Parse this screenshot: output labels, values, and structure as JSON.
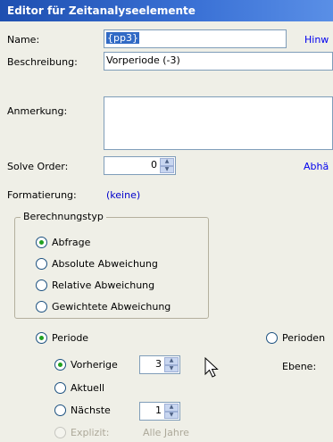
{
  "window": {
    "title": "Editor für Zeitanalyseelemente"
  },
  "form": {
    "name_label": "Name:",
    "name_value": "{pp3}",
    "hint_link": "Hinw",
    "description_label": "Beschreibung:",
    "description_value": "Vorperiode (-3)",
    "remark_label": "Anmerkung:",
    "remark_value": "",
    "solve_order_label": "Solve Order:",
    "solve_order_value": "0",
    "dependency_link": "Abhä",
    "formatting_label": "Formatierung:",
    "formatting_value": "(keine)"
  },
  "calc_type": {
    "legend": "Berechnungstyp",
    "options": [
      "Abfrage",
      "Absolute Abweichung",
      "Relative Abweichung",
      "Gewichtete Abweichung"
    ],
    "selected": "Abfrage"
  },
  "period": {
    "periode_label": "Periode",
    "perioden_label": "Perioden",
    "previous_label": "Vorherige",
    "previous_value": "3",
    "current_label": "Aktuell",
    "next_label": "Nächste",
    "next_value": "1",
    "explicit_label": "Explizit:",
    "all_years_label": "Alle Jahre",
    "level_label": "Ebene:"
  },
  "icons": {
    "spin_up": "▲",
    "spin_down": "▼"
  }
}
